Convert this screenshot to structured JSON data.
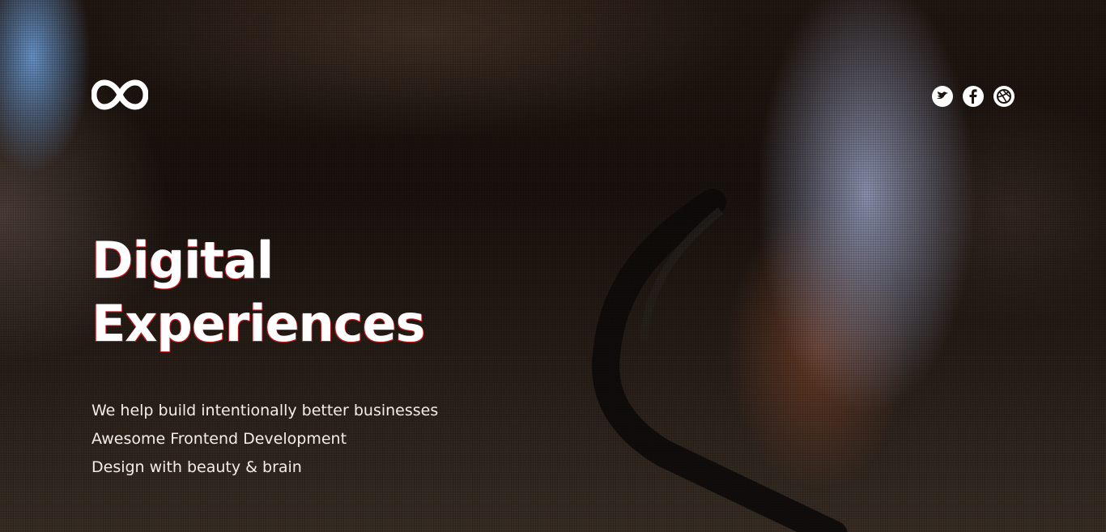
{
  "brand": {
    "logo_icon": "infinity-logo-icon"
  },
  "social": [
    {
      "name": "twitter",
      "icon": "twitter-bird-icon"
    },
    {
      "name": "facebook",
      "icon": "facebook-f-icon"
    },
    {
      "name": "dribbble",
      "icon": "dribbble-ball-icon"
    }
  ],
  "hero": {
    "headline_line1": "Digital",
    "headline_line2": "Experiences",
    "taglines": [
      "We help build intentionally better businesses",
      "Awesome Frontend Development",
      "Design with beauty & brain"
    ]
  },
  "colors": {
    "text": "#ffffff",
    "headline_outline": "#c4161c",
    "background": "#1b1410"
  }
}
